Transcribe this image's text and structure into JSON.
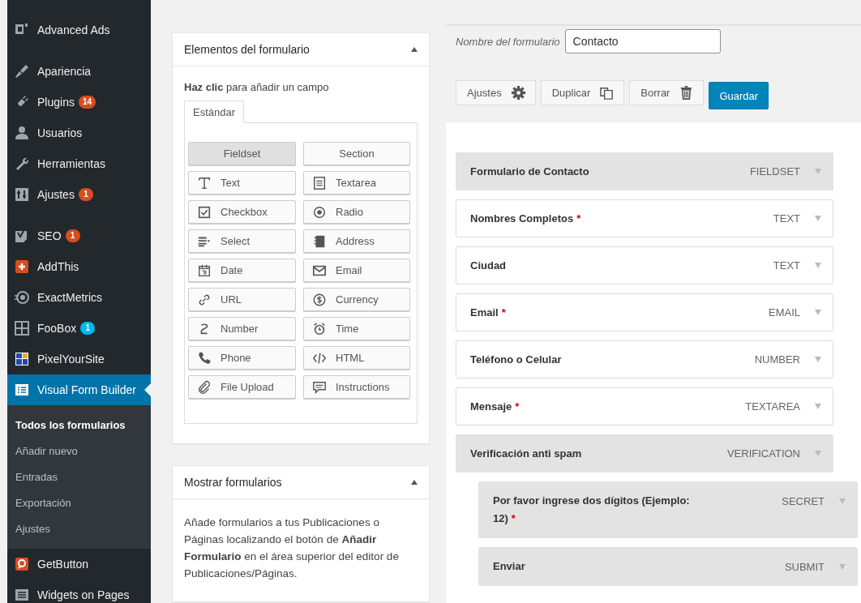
{
  "sidebar": {
    "groups": [
      {
        "items": [
          {
            "label": "Advanced Ads",
            "selected": false
          }
        ]
      },
      {
        "items": [
          {
            "label": "Apariencia",
            "selected": false
          },
          {
            "label": "Plugins",
            "selected": false,
            "badge": {
              "text": "14",
              "color": "#d54e21"
            }
          },
          {
            "label": "Usuarios",
            "selected": false
          },
          {
            "label": "Herramientas",
            "selected": false
          },
          {
            "label": "Ajustes",
            "selected": false,
            "badge": {
              "text": "1",
              "color": "#d54e21"
            }
          }
        ]
      },
      {
        "items": [
          {
            "label": "SEO",
            "selected": false,
            "badge": {
              "text": "1",
              "color": "#d54e21"
            }
          },
          {
            "label": "AddThis",
            "selected": false
          },
          {
            "label": "ExactMetrics",
            "selected": false
          },
          {
            "label": "FooBox",
            "selected": false,
            "badge": {
              "text": "1",
              "color": "#00b9eb"
            }
          },
          {
            "label": "PixelYourSite",
            "selected": false
          },
          {
            "label": "Visual Form Builder",
            "selected": true,
            "submenu": [
              {
                "label": "Todos los formularios",
                "selected": true
              },
              {
                "label": "Añadir nuevo",
                "selected": false
              },
              {
                "label": "Entradas",
                "selected": false
              },
              {
                "label": "Exportación",
                "selected": false
              },
              {
                "label": "Ajustes",
                "selected": false
              }
            ]
          },
          {
            "label": "GetButton",
            "selected": false
          },
          {
            "label": "Widgets on Pages",
            "selected": false
          }
        ]
      }
    ]
  },
  "elements_panel": {
    "title": "Elementos del formulario",
    "expanded": true,
    "hint": "**Haz clic** para añadir un campo",
    "tabs": [
      {
        "label": "Estándar",
        "selected": true
      }
    ],
    "buttons": [
      {
        "label": "Fieldset",
        "selected": true
      },
      {
        "label": "Section",
        "selected": false
      },
      {
        "label": "Text",
        "selected": false
      },
      {
        "label": "Textarea",
        "selected": false
      },
      {
        "label": "Checkbox",
        "selected": false
      },
      {
        "label": "Radio",
        "selected": false
      },
      {
        "label": "Select",
        "selected": false
      },
      {
        "label": "Address",
        "selected": false
      },
      {
        "label": "Date",
        "selected": false
      },
      {
        "label": "Email",
        "selected": false
      },
      {
        "label": "URL",
        "selected": false
      },
      {
        "label": "Currency",
        "selected": false
      },
      {
        "label": "Number",
        "selected": false
      },
      {
        "label": "Time",
        "selected": false
      },
      {
        "label": "Phone",
        "selected": false
      },
      {
        "label": "HTML",
        "selected": false
      },
      {
        "label": "File Upload",
        "selected": false
      },
      {
        "label": "Instructions",
        "selected": false
      }
    ]
  },
  "display_panel": {
    "title": "Mostrar formularios",
    "expanded": true,
    "text": "Añade formularios a tus Publicaciones o Páginas localizando el botón de **Añadir Formulario** en el área superior del editor de Publicaciones/Páginas."
  },
  "form": {
    "name_label": "Nombre del formulario",
    "name_value": "Contacto",
    "actions": [
      {
        "label": "Ajustes",
        "kind": "settings"
      },
      {
        "label": "Duplicar",
        "kind": "duplicate"
      },
      {
        "label": "Borrar",
        "kind": "delete"
      },
      {
        "label": "Guardar",
        "kind": "primary"
      }
    ],
    "fields": [
      {
        "label": "Formulario de Contacto",
        "type": "FIELDSET",
        "kind": "fieldset"
      },
      {
        "label": "Nombres Completos",
        "type": "TEXT",
        "kind": "field",
        "required_mark": "*"
      },
      {
        "label": "Ciudad",
        "type": "TEXT",
        "kind": "field"
      },
      {
        "label": "Email",
        "type": "EMAIL",
        "kind": "field",
        "required_mark": "*"
      },
      {
        "label": "Teléfono o Celular",
        "type": "NUMBER",
        "kind": "field"
      },
      {
        "label": "Mensaje",
        "type": "TEXTAREA",
        "kind": "field",
        "required_mark": "*"
      },
      {
        "label": "Verificación anti spam",
        "type": "VERIFICATION",
        "kind": "fieldset",
        "children": [
          {
            "label": "Por favor ingrese dos dígitos (Ejemplo: 12)",
            "type": "SECRET",
            "kind": "fieldset",
            "required_mark": "*"
          },
          {
            "label": "Enviar",
            "type": "SUBMIT",
            "kind": "fieldset"
          }
        ]
      }
    ]
  }
}
